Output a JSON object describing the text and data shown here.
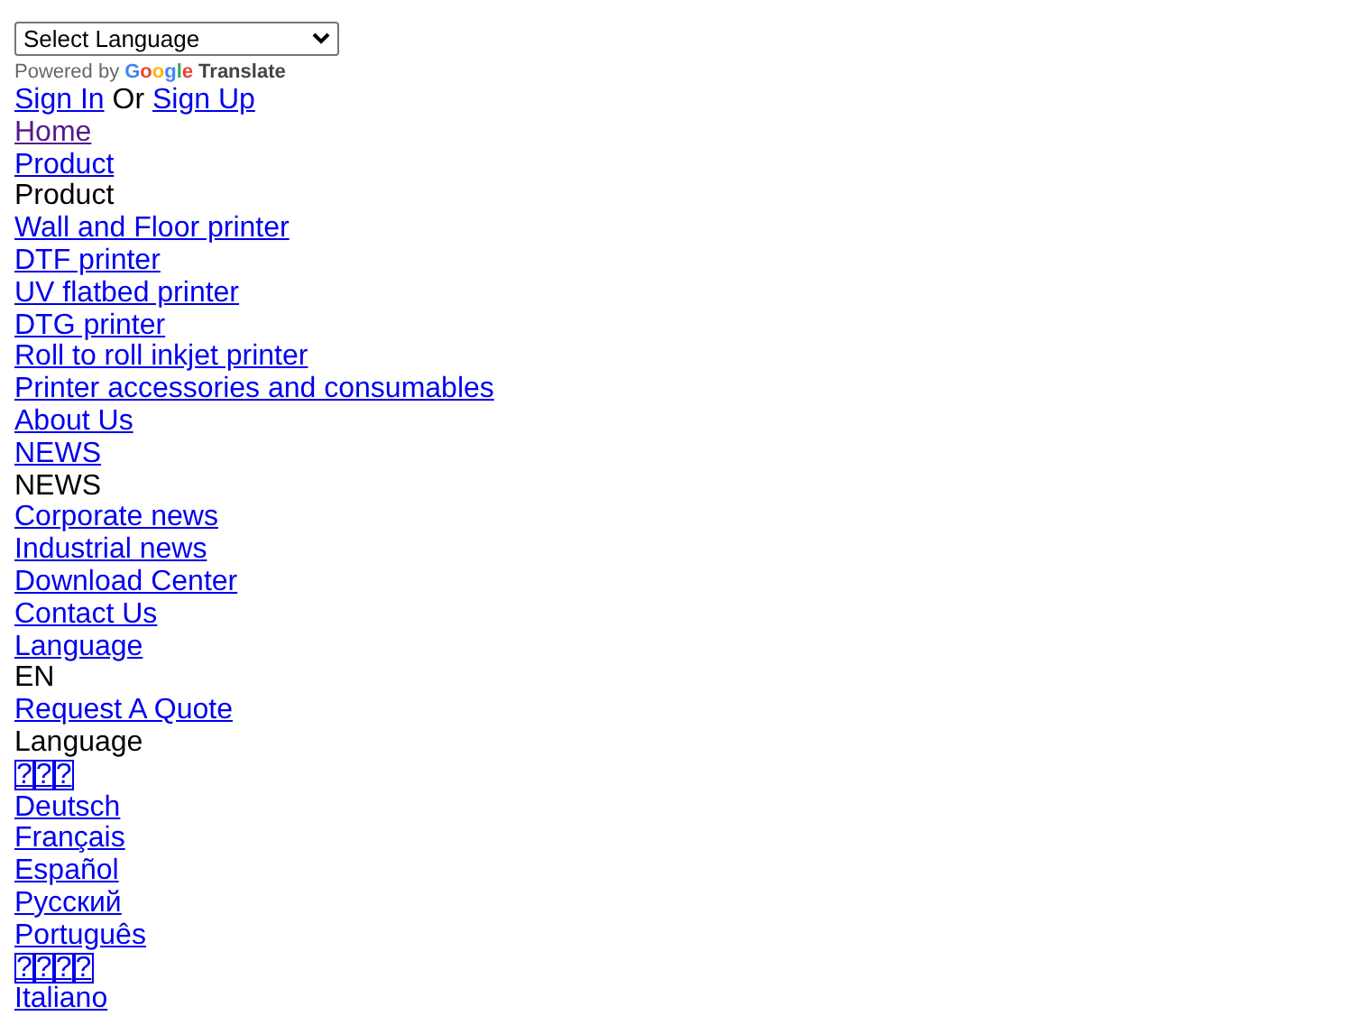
{
  "translate": {
    "select_value": "Select Language",
    "powered_by": "Powered by",
    "brand": "Google",
    "product": "Translate"
  },
  "auth": {
    "sign_in": "Sign In",
    "separator": "Or",
    "sign_up": "Sign Up"
  },
  "items": [
    {
      "kind": "link",
      "text": "Home",
      "visited": true
    },
    {
      "kind": "link",
      "text": "Product",
      "visited": false
    },
    {
      "kind": "text",
      "text": "Product"
    },
    {
      "kind": "link",
      "text": "Wall and Floor printer",
      "visited": false
    },
    {
      "kind": "link",
      "text": "DTF printer",
      "visited": false
    },
    {
      "kind": "link",
      "text": "UV flatbed printer",
      "visited": false
    },
    {
      "kind": "link",
      "text": "DTG printer",
      "visited": false
    },
    {
      "kind": "link",
      "text": "Roll to roll inkjet printer",
      "visited": false
    },
    {
      "kind": "link",
      "text": "Printer accessories and consumables",
      "visited": false
    },
    {
      "kind": "link",
      "text": "About Us",
      "visited": false
    },
    {
      "kind": "link",
      "text": "NEWS",
      "visited": false
    },
    {
      "kind": "text",
      "text": "NEWS"
    },
    {
      "kind": "link",
      "text": "Corporate news",
      "visited": false
    },
    {
      "kind": "link",
      "text": "Industrial news",
      "visited": false
    },
    {
      "kind": "link",
      "text": "Download Center",
      "visited": false
    },
    {
      "kind": "link",
      "text": "Contact Us",
      "visited": false
    },
    {
      "kind": "link",
      "text": "Language",
      "visited": false
    },
    {
      "kind": "text",
      "text": "EN"
    },
    {
      "kind": "link",
      "text": "Request A Quote",
      "visited": false
    },
    {
      "kind": "text",
      "text": "Language"
    },
    {
      "kind": "tofu",
      "text": "???",
      "visited": false
    },
    {
      "kind": "link",
      "text": "Deutsch",
      "visited": false
    },
    {
      "kind": "link",
      "text": "Français",
      "visited": false
    },
    {
      "kind": "link",
      "text": "Español",
      "visited": false
    },
    {
      "kind": "link",
      "text": "Русский",
      "visited": false
    },
    {
      "kind": "link",
      "text": "Português",
      "visited": false
    },
    {
      "kind": "tofu",
      "text": "????",
      "visited": false
    },
    {
      "kind": "link",
      "text": "Italiano",
      "visited": false
    }
  ]
}
